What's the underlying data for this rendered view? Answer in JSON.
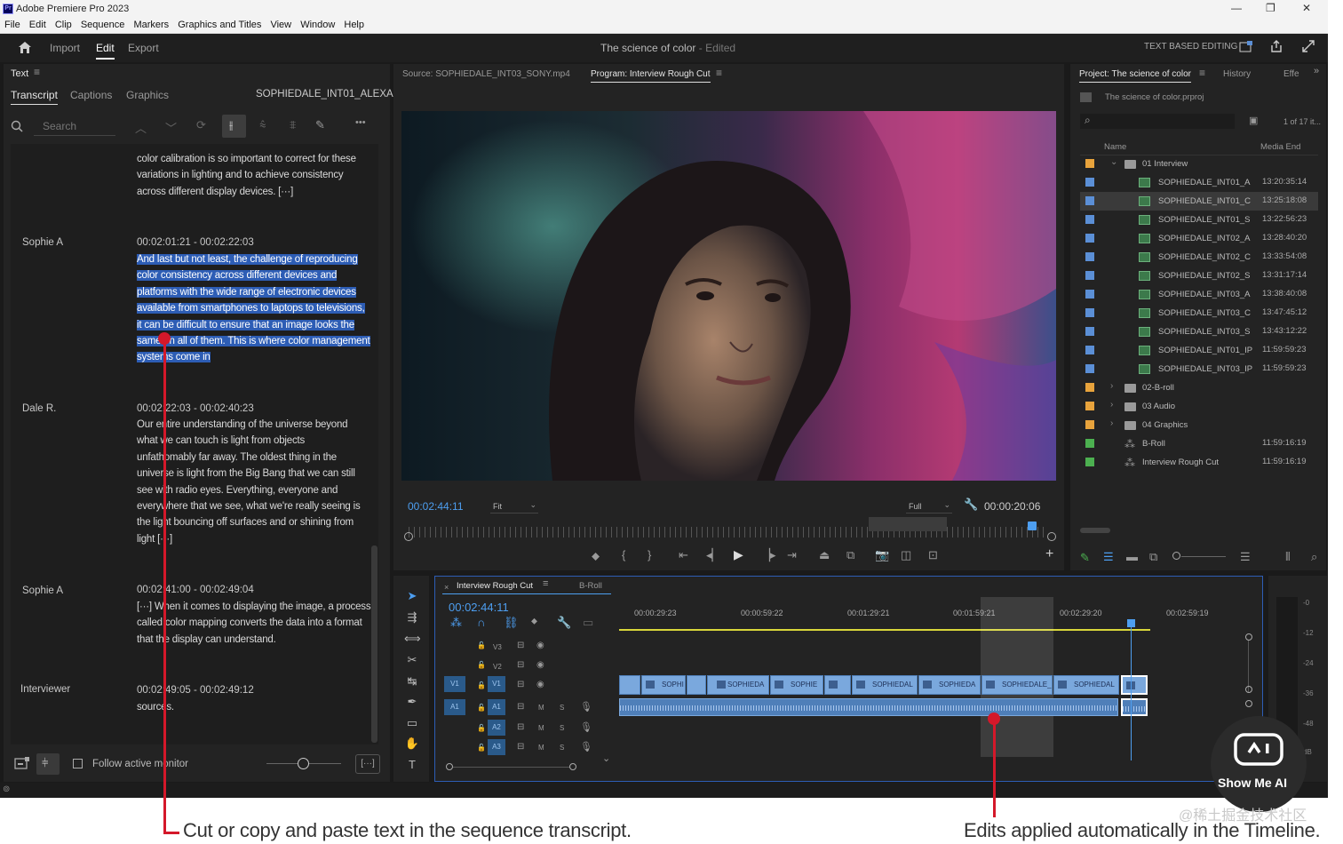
{
  "titlebar": {
    "app": "Adobe Premiere Pro 2023",
    "logo": "Pr",
    "min": "—",
    "restore": "❐",
    "close": "✕"
  },
  "menu": [
    "File",
    "Edit",
    "Clip",
    "Sequence",
    "Markers",
    "Graphics and Titles",
    "View",
    "Window",
    "Help"
  ],
  "header": {
    "tabs": [
      "Import",
      "Edit",
      "Export"
    ],
    "project_title": "The science of color",
    "edited": "- Edited",
    "text_based_editing": "TEXT BASED EDITING"
  },
  "text_panel": {
    "title": "Text",
    "tabs": [
      "Transcript",
      "Captions",
      "Graphics"
    ],
    "clip_name": "SOPHIEDALE_INT01_ALEXA",
    "search_placeholder": "Search",
    "more": "•••",
    "blocks": [
      {
        "speaker": "",
        "time": "",
        "lines": [
          "color calibration is so important to correct for these",
          "variations in lighting and to achieve consistency",
          "across different display devices. [···]"
        ]
      },
      {
        "speaker": "Sophie A",
        "time": "00:02:01:21 - 00:02:22:03",
        "lines": [
          "And last but not least, the challenge of reproducing",
          "color consistency across different devices and",
          "platforms with the wide range of electronic devices",
          "available from smartphones to laptops to televisions,",
          "it can be difficult to ensure that an image looks the",
          "same on all of them. This is where color management",
          "systems come in"
        ]
      },
      {
        "speaker": "Dale R.",
        "time": "00:02:22:03 - 00:02:40:23",
        "lines": [
          "Our entire understanding of the universe beyond",
          "what we can touch is light from objects",
          "unfathomably far away. The oldest thing in the",
          "universe is light from the Big Bang that we can still",
          "see with radio eyes. Everything, everyone and",
          "everywhere that we see, what we're really seeing is",
          "the light bouncing off surfaces and or shining from",
          "light [···]"
        ]
      },
      {
        "speaker": "Sophie A",
        "time": "00:02:41:00 - 00:02:49:04",
        "lines": [
          "[···] When it comes to displaying the image, a process",
          "called color mapping converts the data into a format",
          "that the display can understand."
        ]
      },
      {
        "speaker": "Interviewer",
        "time": "00:02:49:05 - 00:02:49:12",
        "lines": [
          "sources."
        ]
      }
    ],
    "follow_label": "Follow active monitor",
    "ellipsis_btn": "[···]"
  },
  "monitor": {
    "source_tab": "Source: SOPHIEDALE_INT03_SONY.mp4",
    "program_tab": "Program: Interview Rough Cut",
    "timecode": "00:02:44:11",
    "fit": "Fit",
    "quality": "Full",
    "duration": "00:00:20:06",
    "playhead_fraction": 0.98
  },
  "project": {
    "tabs": [
      "Project: The science of color",
      "History",
      "Effe"
    ],
    "file": "The science of color.prproj",
    "count": "1 of 17 it...",
    "col_name": "Name",
    "col_end": "Media End",
    "rows": [
      {
        "type": "folder",
        "open": true,
        "color": "#e8a33c",
        "name": "01 Interview",
        "end": ""
      },
      {
        "type": "clip",
        "color": "#5b8fd6",
        "name": "SOPHIEDALE_INT01_A",
        "end": "13:20:35:14"
      },
      {
        "type": "clip",
        "color": "#5b8fd6",
        "name": "SOPHIEDALE_INT01_C",
        "end": "13:25:18:08",
        "selected": true
      },
      {
        "type": "clip",
        "color": "#5b8fd6",
        "name": "SOPHIEDALE_INT01_S",
        "end": "13:22:56:23"
      },
      {
        "type": "clip",
        "color": "#5b8fd6",
        "name": "SOPHIEDALE_INT02_A",
        "end": "13:28:40:20"
      },
      {
        "type": "clip",
        "color": "#5b8fd6",
        "name": "SOPHIEDALE_INT02_C",
        "end": "13:33:54:08"
      },
      {
        "type": "clip",
        "color": "#5b8fd6",
        "name": "SOPHIEDALE_INT02_S",
        "end": "13:31:17:14"
      },
      {
        "type": "clip",
        "color": "#5b8fd6",
        "name": "SOPHIEDALE_INT03_A",
        "end": "13:38:40:08"
      },
      {
        "type": "clip",
        "color": "#5b8fd6",
        "name": "SOPHIEDALE_INT03_C",
        "end": "13:47:45:12"
      },
      {
        "type": "clip",
        "color": "#5b8fd6",
        "name": "SOPHIEDALE_INT03_S",
        "end": "13:43:12:22"
      },
      {
        "type": "clip",
        "color": "#5b8fd6",
        "name": "SOPHIEDALE_INT01_IP",
        "end": "11:59:59:23"
      },
      {
        "type": "clip",
        "color": "#5b8fd6",
        "name": "SOPHIEDALE_INT03_IP",
        "end": "11:59:59:23"
      },
      {
        "type": "folder",
        "open": false,
        "color": "#e8a33c",
        "name": "02-B-roll",
        "end": ""
      },
      {
        "type": "folder",
        "open": false,
        "color": "#e8a33c",
        "name": "03 Audio",
        "end": ""
      },
      {
        "type": "folder",
        "open": false,
        "color": "#e8a33c",
        "name": "04 Graphics",
        "end": ""
      },
      {
        "type": "seq",
        "color": "#4cb050",
        "name": "B-Roll",
        "end": "11:59:16:19"
      },
      {
        "type": "seq",
        "color": "#4cb050",
        "name": "Interview Rough Cut",
        "end": "11:59:16:19"
      }
    ]
  },
  "timeline": {
    "tabs": [
      "Interview Rough Cut",
      "B-Roll"
    ],
    "timecode": "00:02:44:11",
    "ruler": [
      "00:00:29:23",
      "00:00:59:22",
      "00:01:29:21",
      "00:01:59:21",
      "00:02:29:20",
      "00:02:59:19"
    ],
    "tracks_v": [
      "V3",
      "V2",
      "V1"
    ],
    "tracks_a": [
      "A1",
      "A2",
      "A3"
    ],
    "v1_src": "V1",
    "a1_src": "A1",
    "m": "M",
    "s": "S",
    "clips": [
      "SOPHI",
      "SOPHIEDA",
      "SOPHIE",
      "SOPHIEDAL",
      "SOPHIEDA",
      "SOPHIEDALE_",
      "SOPHIEDAL"
    ],
    "meter_labels": [
      "-0",
      "-12",
      "-24",
      "-36",
      "-48",
      "dB"
    ]
  },
  "captions": {
    "left": "Cut or copy and paste text in the sequence transcript.",
    "right": "Edits applied automatically in the Timeline."
  },
  "badge": {
    "name": "Show Me AI"
  },
  "watermark": "@稀土掘金技术社区"
}
